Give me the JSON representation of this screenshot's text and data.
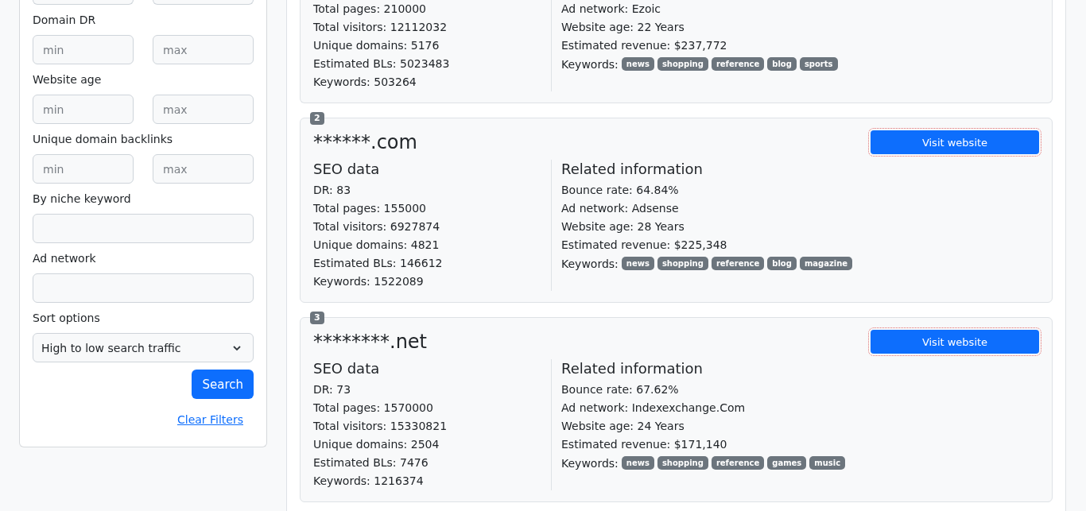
{
  "filters": {
    "ranges": [
      {
        "label": "Domain DR",
        "min_placeholder": "min",
        "max_placeholder": "max"
      },
      {
        "label": "Website age",
        "min_placeholder": "min",
        "max_placeholder": "max"
      },
      {
        "label": "Unique domain backlinks",
        "min_placeholder": "min",
        "max_placeholder": "max"
      }
    ],
    "text_fields": [
      {
        "label": "By niche keyword"
      },
      {
        "label": "Ad network"
      }
    ],
    "sort": {
      "label": "Sort options",
      "value": "High to low search traffic"
    },
    "search_button": "Search",
    "clear_link": "Clear Filters"
  },
  "results": [
    {
      "seo_lines": [
        "Total pages: 210000",
        "Total visitors: 12112032",
        "Unique domains: 5176",
        "Estimated BLs: 5023483",
        "Keywords: 503264"
      ],
      "related_lines": [
        "Ad network: Ezoic",
        "Website age: 22 Years",
        "Estimated revenue: $237,772"
      ],
      "keywords_label": "Keywords:",
      "keywords": [
        "news",
        "shopping",
        "reference",
        "blog",
        "sports"
      ]
    },
    {
      "rank": "2",
      "domain": "******.com",
      "button": "Visit website",
      "seo_title": "SEO data",
      "seo_lines": [
        "DR: 83",
        "Total pages: 155000",
        "Total visitors: 6927874",
        "Unique domains: 4821",
        "Estimated BLs: 146612",
        "Keywords: 1522089"
      ],
      "related_title": "Related information",
      "related_lines": [
        "Bounce rate: 64.84%",
        "Ad network: Adsense",
        "Website age: 28 Years",
        "Estimated revenue: $225,348"
      ],
      "keywords_label": "Keywords:",
      "keywords": [
        "news",
        "shopping",
        "reference",
        "blog",
        "magazine"
      ]
    },
    {
      "rank": "3",
      "domain": "********.net",
      "button": "Visit website",
      "seo_title": "SEO data",
      "seo_lines": [
        "DR: 73",
        "Total pages: 1570000",
        "Total visitors: 15330821",
        "Unique domains: 2504",
        "Estimated BLs: 7476",
        "Keywords: 1216374"
      ],
      "related_title": "Related information",
      "related_lines": [
        "Bounce rate: 67.62%",
        "Ad network: Indexexchange.Com",
        "Website age: 24 Years",
        "Estimated revenue: $171,140"
      ],
      "keywords_label": "Keywords:",
      "keywords": [
        "news",
        "shopping",
        "reference",
        "games",
        "music"
      ]
    }
  ]
}
